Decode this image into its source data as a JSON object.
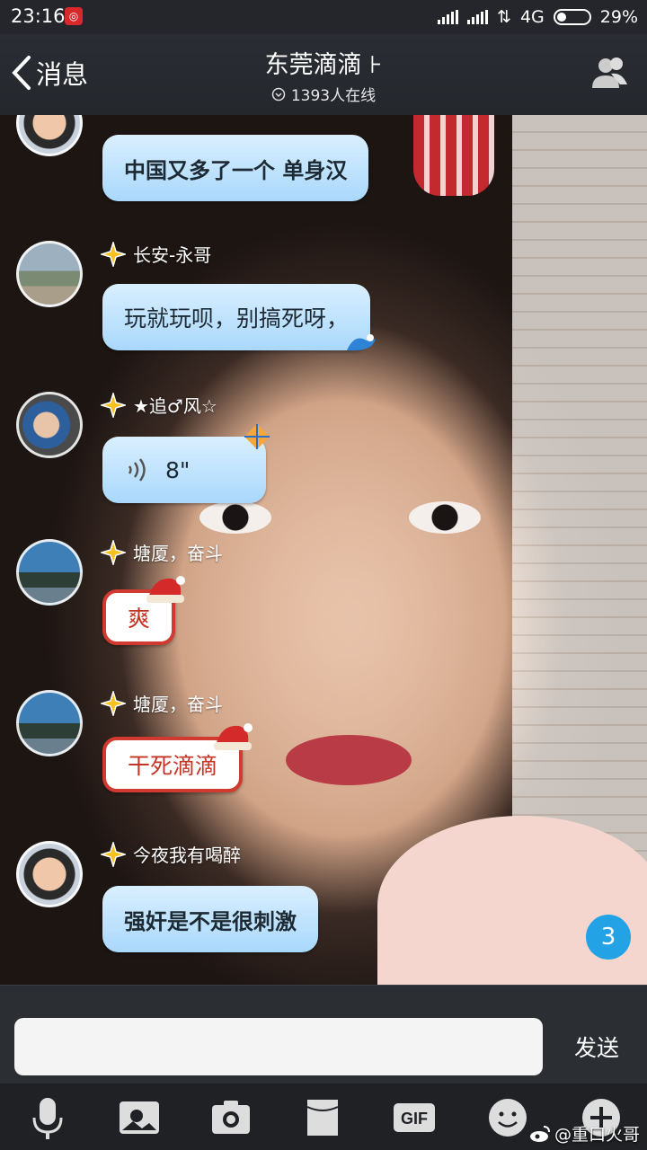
{
  "status_bar": {
    "time": "23:16",
    "app_badge_icon": "netease-music-icon",
    "network": "4G",
    "battery": "29%",
    "battery_level": 0.29
  },
  "header": {
    "back_label": "消息",
    "title": "东莞滴滴",
    "title_suffix": "⊦",
    "online": "1393人在线"
  },
  "messages": [
    {
      "sender": "",
      "text": "中国又多了一个 单身汉",
      "style": "handwritten"
    },
    {
      "sender": "长安-永哥",
      "text": "玩就玩呗，别搞死呀，",
      "style": "wave"
    },
    {
      "sender": "★追♂风☆",
      "text": "8\"",
      "style": "voice"
    },
    {
      "sender": "塘厦，奋斗",
      "text": "爽",
      "style": "festive"
    },
    {
      "sender": "塘厦，奋斗",
      "text": "干死滴滴",
      "style": "festive"
    },
    {
      "sender": "今夜我有喝醉",
      "text": "强奸是不是很刺激",
      "style": "handwritten"
    }
  ],
  "unread_count": "3",
  "input": {
    "value": "",
    "send_label": "发送"
  },
  "toolbar": {
    "icons": [
      "microphone-icon",
      "photo-icon",
      "camera-icon",
      "file-icon",
      "gif-icon",
      "emoji-icon",
      "plus-icon"
    ],
    "gif_label": "GIF"
  },
  "watermark": "@重口火哥",
  "colors": {
    "bubble": "#a9d8fb",
    "unread": "#23a3e6",
    "festive_border": "#d13a30"
  }
}
